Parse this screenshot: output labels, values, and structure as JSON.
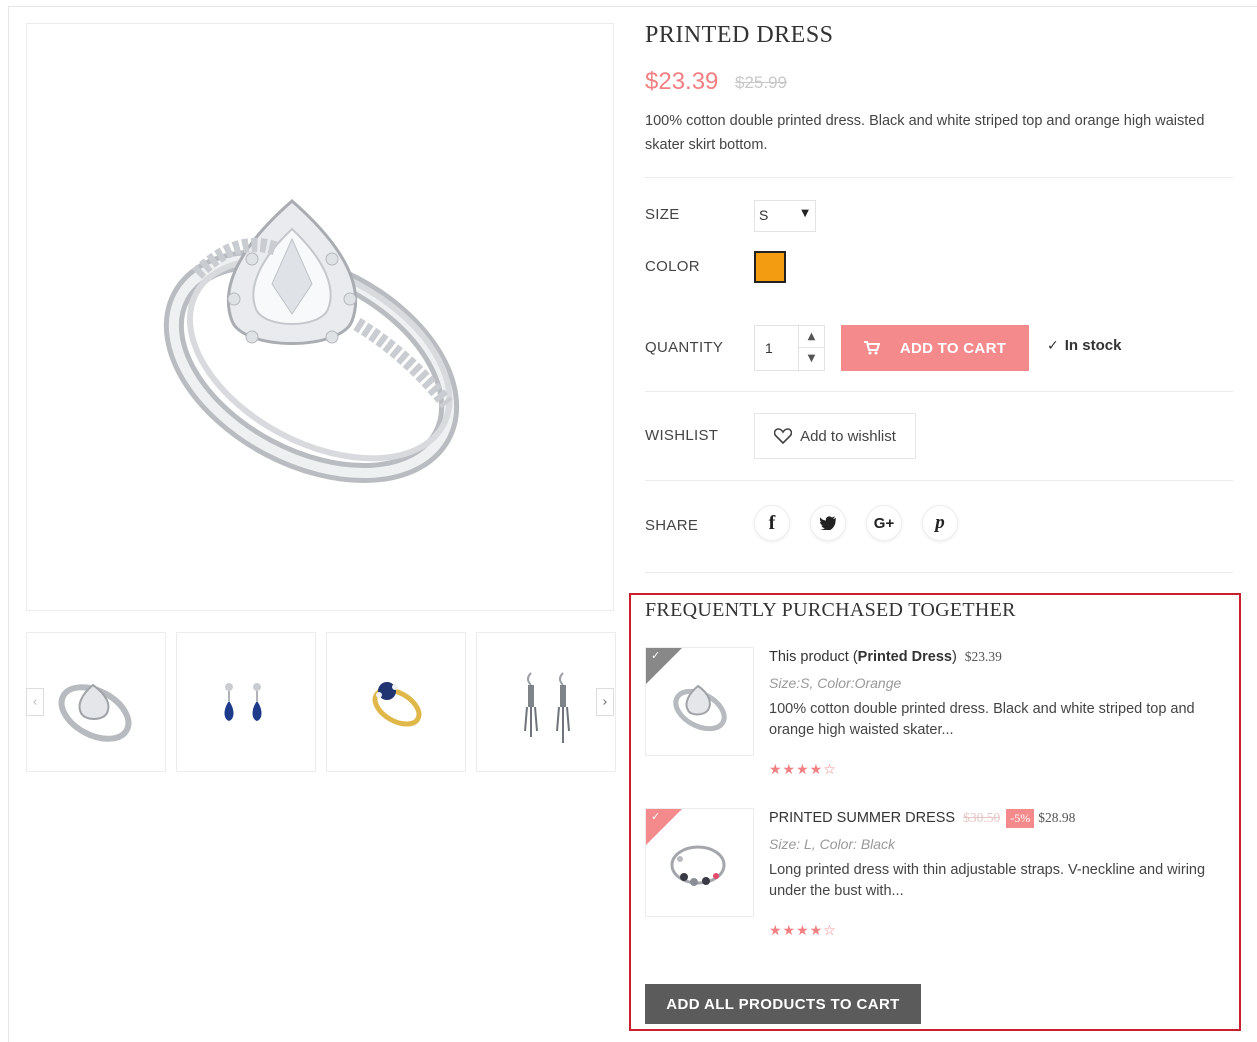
{
  "product": {
    "title": "PRINTED DRESS",
    "price": "$23.39",
    "old_price": "$25.99",
    "description": "100% cotton double printed dress. Black and white striped top and orange high waisted skater skirt bottom."
  },
  "options": {
    "size_label": "SIZE",
    "size_value": "S",
    "color_label": "COLOR",
    "color_swatch": "#f39c12",
    "quantity_label": "QUANTITY",
    "quantity_value": "1",
    "add_to_cart_label": "ADD TO CART",
    "stock_text": "In stock",
    "wishlist_label": "WISHLIST",
    "wishlist_button": "Add to wishlist",
    "share_label": "SHARE"
  },
  "share_icons": [
    {
      "name": "facebook-icon",
      "glyph": "f"
    },
    {
      "name": "twitter-icon",
      "glyph": "t"
    },
    {
      "name": "google-plus-icon",
      "glyph": "G+"
    },
    {
      "name": "pinterest-icon",
      "glyph": "P"
    }
  ],
  "thumbnails": [
    {
      "name": "thumb-ring",
      "icon": "ring"
    },
    {
      "name": "thumb-sapphire-earrings",
      "icon": "earrings"
    },
    {
      "name": "thumb-gold-ring",
      "icon": "gold-ring"
    },
    {
      "name": "thumb-drop-earrings",
      "icon": "drop-earrings"
    }
  ],
  "fbt": {
    "title": "FREQUENTLY PURCHASED TOGETHER",
    "items": [
      {
        "prefix": "This product (",
        "name": "Printed Dress",
        "suffix": ")",
        "price": "$23.39",
        "attributes": "Size:S, Color:Orange",
        "description": "100% cotton double printed dress. Black and white striped top and orange high waisted skater...",
        "rating": 4
      },
      {
        "name": "PRINTED SUMMER DRESS",
        "old_price": "$30.50",
        "discount": "-5%",
        "price": "$28.98",
        "attributes": "Size: L, Color: Black",
        "description": "Long printed dress with thin adjustable straps. V-neckline and wiring under the bust with...",
        "rating": 4
      }
    ],
    "add_all_label": "ADD ALL PRODUCTS TO CART"
  },
  "colors": {
    "accent": "#f58a8c",
    "price": "#f27f81",
    "highlight_border": "#c8202f",
    "dark_button": "#5b5b5b"
  }
}
